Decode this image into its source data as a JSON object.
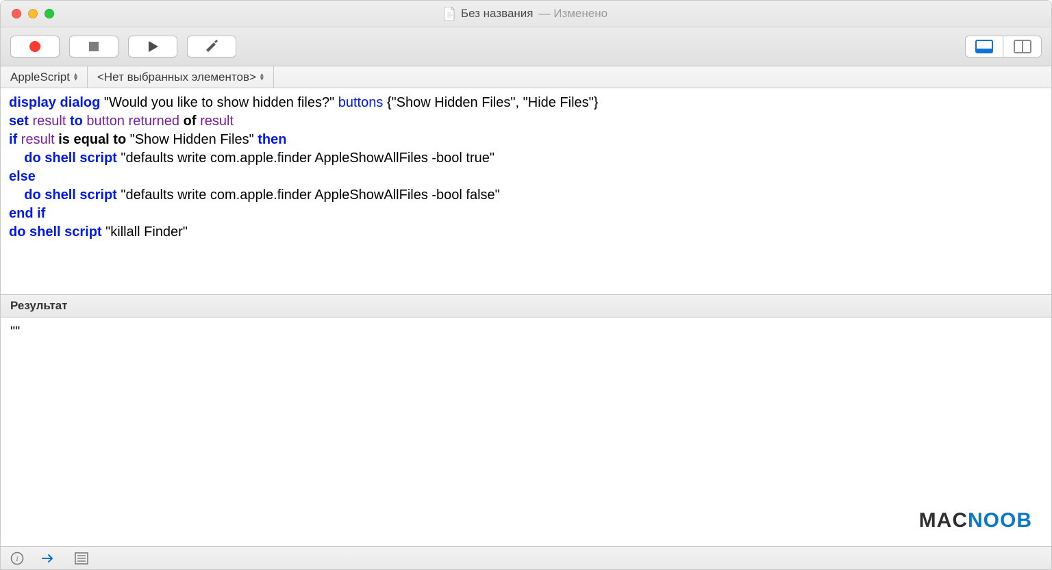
{
  "window": {
    "title": "Без названия",
    "status": "Изменено"
  },
  "navbar": {
    "language": "AppleScript",
    "path": "<Нет выбранных элементов>"
  },
  "code": {
    "l1": {
      "a": "display dialog",
      "b": "\"Would you like to show hidden files?\"",
      "c": "buttons",
      "d": "{\"Show Hidden Files\", \"Hide Files\"}"
    },
    "l2": {
      "a": "set",
      "b": "result",
      "c": "to",
      "d": "button returned",
      "e": "of",
      "f": "result"
    },
    "l3": {
      "a": "if",
      "b": "result",
      "c": "is equal to",
      "d": "\"Show Hidden Files\"",
      "e": "then"
    },
    "l4": {
      "a": "do shell script",
      "b": "\"defaults write com.apple.finder AppleShowAllFiles -bool true\""
    },
    "l5": {
      "a": "else"
    },
    "l6": {
      "a": "do shell script",
      "b": "\"defaults write com.apple.finder AppleShowAllFiles -bool false\""
    },
    "l7": {
      "a": "end if"
    },
    "l8": {
      "a": "do shell script",
      "b": "\"killall Finder\""
    }
  },
  "result": {
    "header": "Результат",
    "value": "\"\""
  },
  "watermark": {
    "part1": "MAC",
    "part2": "NOOB"
  }
}
